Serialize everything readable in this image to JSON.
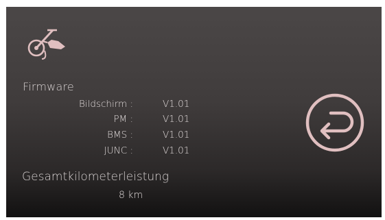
{
  "firmware": {
    "title": "Firmware",
    "rows": [
      {
        "label": "Bildschirm :",
        "value": "V1.01"
      },
      {
        "label": "PM :",
        "value": "V1.01"
      },
      {
        "label": "BMS :",
        "value": "V1.01"
      },
      {
        "label": "JUNC :",
        "value": "V1.01"
      }
    ]
  },
  "total_distance": {
    "title": "Gesamtkilometerleistung",
    "value": "8 km"
  },
  "icons": {
    "logo": "handbike-icon",
    "back": "back-arrow-icon"
  },
  "colors": {
    "accent": "#e0bfc0",
    "text": "#e2dcdc"
  }
}
